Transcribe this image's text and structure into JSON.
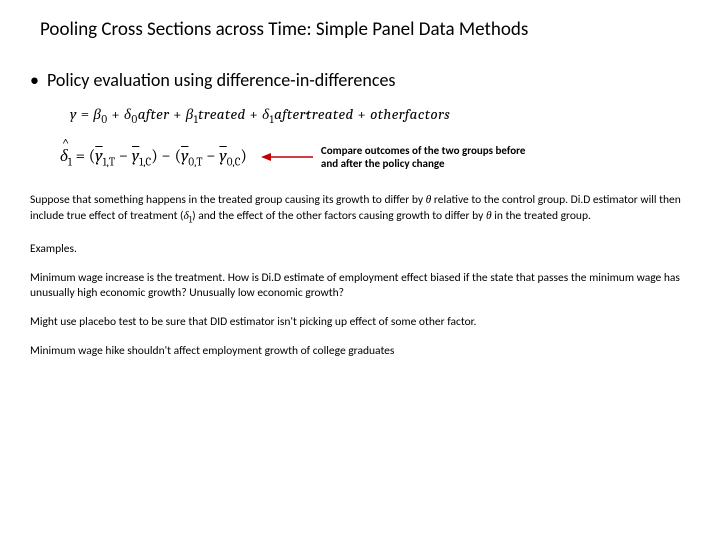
{
  "title": "Pooling Cross Sections across Time: Simple Panel Data Methods",
  "bullet": "Policy evaluation using difference-in-differences",
  "eq_main_html": "<span>y</span> <span class='rm'>=</span> <span>β</span><sub>0</sub> <span class='rm'>+</span> <span>δ</span><sub>0</sub><span>after</span> <span class='rm'>+</span> <span>β</span><sub>1</sub><span>treated</span> <span class='rm'>+</span> <span>δ</span><sub>1</sub><span>after·treated</span> <span class='rm'>+</span> <span>otherfactors</span>",
  "eq_did_html": "<span class='hat'>δ</span><sub>1</sub> <span class='rm'>= (</span><span class='bar'>y</span><sub>1,T</sub> <span class='rm'>−</span> <span class='bar'>y</span><sub>1,C</sub><span class='rm'>) − (</span><span class='bar'>y</span><sub>0,T</sub> <span class='rm'>−</span> <span class='bar'>y</span><sub>0,C</sub><span class='rm'>)</span>",
  "annotation": "Compare outcomes of the two groups before and after the policy change",
  "p1_html": "Suppose that something happens in the treated group causing its growth to differ by <span class='inline-math'>θ</span> relative to the control group.  Di.D estimator will then include true effect of treatment (<span class='inline-math'>δ<sub>1</sub></span>) and the effect of the other factors causing growth to differ by <span class='inline-math'>θ</span> in the treated group.",
  "p2": "Examples.",
  "p3": "Minimum wage increase is the treatment.   How is Di.D estimate of employment effect biased if the state that passes the minimum wage  has unusually high economic growth?  Unusually low economic growth?",
  "p4": "Might use placebo test to be sure that DID estimator isn't picking up effect of some other factor.",
  "p5": "Minimum wage hike shouldn't affect employment growth of college graduates",
  "arrow_color": "#c00000"
}
